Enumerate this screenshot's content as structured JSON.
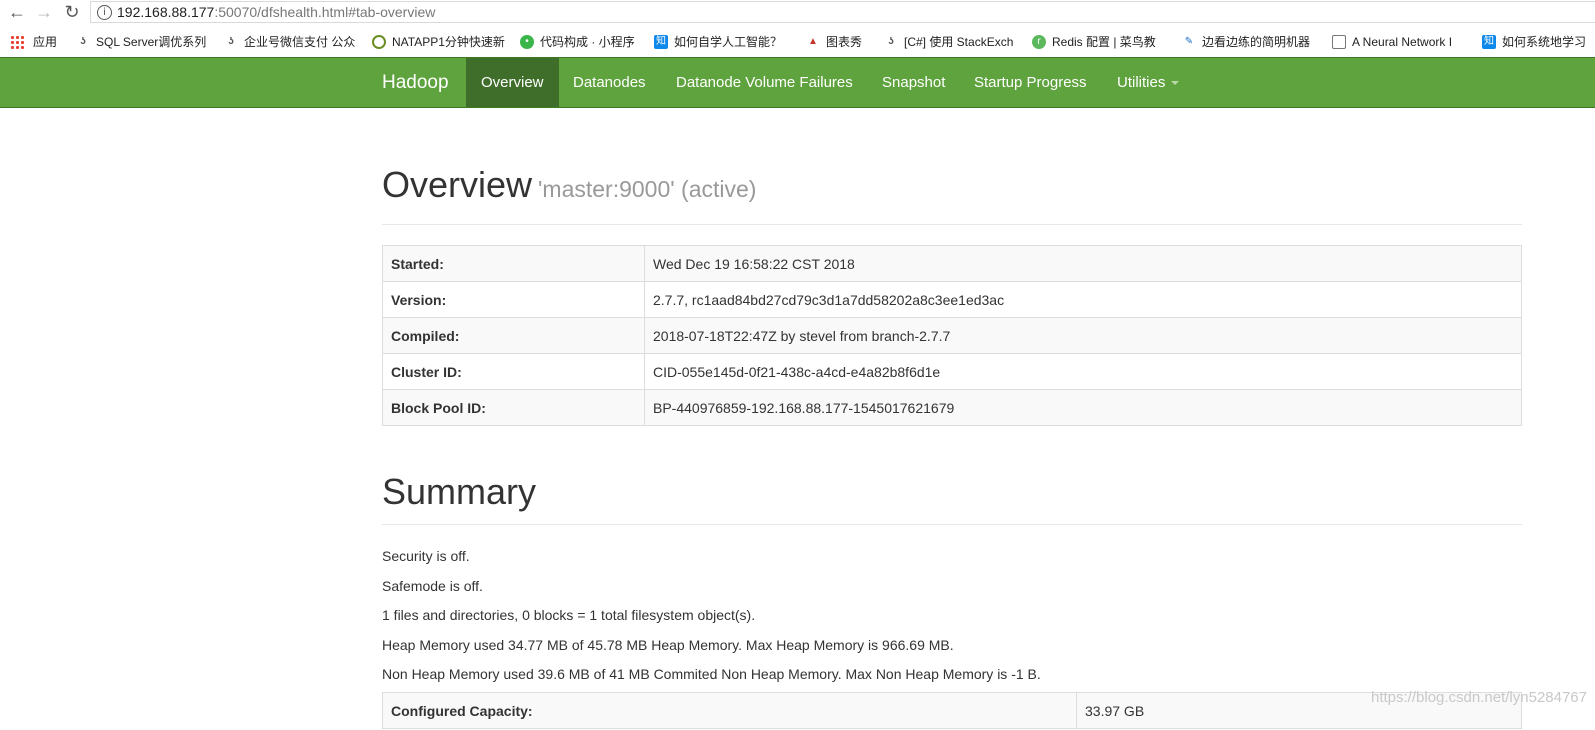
{
  "browser": {
    "url_host": "192.168.88.177",
    "url_rest": ":50070/dfshealth.html#tab-overview"
  },
  "bookmarks": [
    {
      "label": "应用",
      "icon": "apps-grid-icon"
    },
    {
      "label": "SQL Server调优系列",
      "icon": "csdn-icon"
    },
    {
      "label": "企业号微信支付 公众",
      "icon": "csdn-icon"
    },
    {
      "label": "NATAPP1分钟快速新",
      "icon": "natapp-icon"
    },
    {
      "label": "代码构成 · 小程序",
      "icon": "wechat-icon"
    },
    {
      "label": "如何自学人工智能？",
      "icon": "zhihu-icon"
    },
    {
      "label": "图表秀",
      "icon": "chart-icon"
    },
    {
      "label": "[C#] 使用 StackExch",
      "icon": "csdn-icon"
    },
    {
      "label": "Redis 配置 | 菜鸟教",
      "icon": "runoob-icon"
    },
    {
      "label": "边看边练的简明机器",
      "icon": "feather-icon"
    },
    {
      "label": "A Neural Network I",
      "icon": "page-icon"
    },
    {
      "label": "如何系统地学习",
      "icon": "zhihu-icon"
    }
  ],
  "navbar": {
    "brand": "Hadoop",
    "items": [
      {
        "label": "Overview"
      },
      {
        "label": "Datanodes"
      },
      {
        "label": "Datanode Volume Failures"
      },
      {
        "label": "Snapshot"
      },
      {
        "label": "Startup Progress"
      },
      {
        "label": "Utilities"
      }
    ]
  },
  "overview": {
    "title": "Overview",
    "subtitle": "'master:9000' (active)",
    "rows": [
      {
        "key": "Started:",
        "value": "Wed Dec 19 16:58:22 CST 2018"
      },
      {
        "key": "Version:",
        "value": "2.7.7, rc1aad84bd27cd79c3d1a7dd58202a8c3ee1ed3ac"
      },
      {
        "key": "Compiled:",
        "value": "2018-07-18T22:47Z by stevel from branch-2.7.7"
      },
      {
        "key": "Cluster ID:",
        "value": "CID-055e145d-0f21-438c-a4cd-e4a82b8f6d1e"
      },
      {
        "key": "Block Pool ID:",
        "value": "BP-440976859-192.168.88.177-1545017621679"
      }
    ]
  },
  "summary": {
    "title": "Summary",
    "lines": [
      "Security is off.",
      "Safemode is off.",
      "1 files and directories, 0 blocks = 1 total filesystem object(s).",
      "Heap Memory used 34.77 MB of 45.78 MB Heap Memory. Max Heap Memory is 966.69 MB.",
      "Non Heap Memory used 39.6 MB of 41 MB Commited Non Heap Memory. Max Non Heap Memory is -1 B."
    ],
    "capacity_row": {
      "key": "Configured Capacity:",
      "value": "33.97 GB"
    }
  },
  "watermark": "https://blog.csdn.net/lyn5284767"
}
